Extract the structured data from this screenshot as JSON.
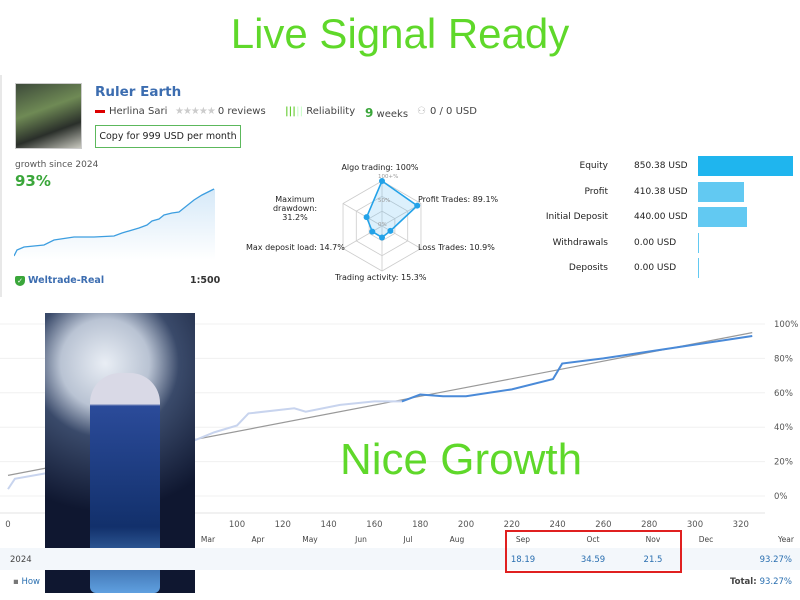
{
  "headline": "Live Signal Ready",
  "overlay_text": "Nice Growth",
  "signal": {
    "name": "Ruler Earth",
    "author": "Herlina Sari",
    "reviews": "0 reviews",
    "reliability": "Reliability",
    "weeks_num": "9",
    "weeks_label": "weeks",
    "subscribers": "0 / 0 USD",
    "copy_button": "Copy for 999 USD per month",
    "rating_stars": 0
  },
  "growth": {
    "label": "growth since 2024",
    "value": "93%",
    "broker": "Weltrade-Real",
    "leverage": "1:500"
  },
  "radar": {
    "algo": "Algo trading: 100%",
    "profit": "Profit Trades: 89.1%",
    "loss": "Loss Trades: 10.9%",
    "activity": "Trading activity: 15.3%",
    "load": "Max deposit load: 14.7%",
    "drawdown": "Maximum drawdown:",
    "drawdown_val": "31.2%",
    "ring100": "100+%",
    "ring50": "50%",
    "ring0": "0%",
    "values": [
      100,
      89.1,
      10.9,
      15.3,
      14.7,
      31.2
    ]
  },
  "stats": [
    {
      "label": "Equity",
      "value": "850.38 USD",
      "amount": 850.38,
      "color": "#1fb5ee"
    },
    {
      "label": "Profit",
      "value": "410.38 USD",
      "amount": 410.38,
      "color": "#62c9f2"
    },
    {
      "label": "Initial Deposit",
      "value": "440.00 USD",
      "amount": 440.0,
      "color": "#62c9f2"
    },
    {
      "label": "Withdrawals",
      "value": "0.00 USD",
      "amount": 0,
      "color": "#62c9f2"
    },
    {
      "label": "Deposits",
      "value": "0.00 USD",
      "amount": 0,
      "color": "#62c9f2"
    }
  ],
  "chart_data": {
    "type": "line",
    "x_ticks": [
      "0",
      "100",
      "120",
      "140",
      "160",
      "180",
      "200",
      "220",
      "240",
      "260",
      "280",
      "300",
      "320"
    ],
    "y_ticks": [
      "100%",
      "80%",
      "60%",
      "40%",
      "20%",
      "0%"
    ],
    "xlim": [
      0,
      325
    ],
    "ylim": [
      -10,
      105
    ],
    "series": [
      {
        "values": [
          [
            0,
            4
          ],
          [
            3,
            10
          ],
          [
            20,
            14
          ],
          [
            40,
            18
          ],
          [
            60,
            24
          ],
          [
            79,
            31
          ],
          [
            90,
            37
          ],
          [
            100,
            41
          ],
          [
            105,
            48
          ],
          [
            125,
            51
          ],
          [
            130,
            49
          ],
          [
            145,
            53
          ],
          [
            160,
            55
          ],
          [
            172,
            55
          ],
          [
            180,
            59
          ],
          [
            190,
            58
          ],
          [
            200,
            58
          ],
          [
            220,
            62
          ],
          [
            238,
            68
          ],
          [
            242,
            77
          ],
          [
            260,
            80
          ],
          [
            280,
            84
          ],
          [
            300,
            88
          ],
          [
            325,
            93
          ]
        ]
      }
    ],
    "trend": [
      [
        0,
        12
      ],
      [
        325,
        95
      ]
    ]
  },
  "returns": {
    "months": [
      "Mar",
      "Apr",
      "May",
      "Jun",
      "Jul",
      "Aug",
      "Sep",
      "Oct",
      "Nov",
      "Dec",
      "Year"
    ],
    "year": "2024",
    "values": {
      "Sep": "18.19",
      "Oct": "34.59",
      "Nov": "21.5"
    },
    "year_total": "93.27%",
    "total_label": "Total:",
    "total": "93.27%",
    "how_link": "How"
  }
}
